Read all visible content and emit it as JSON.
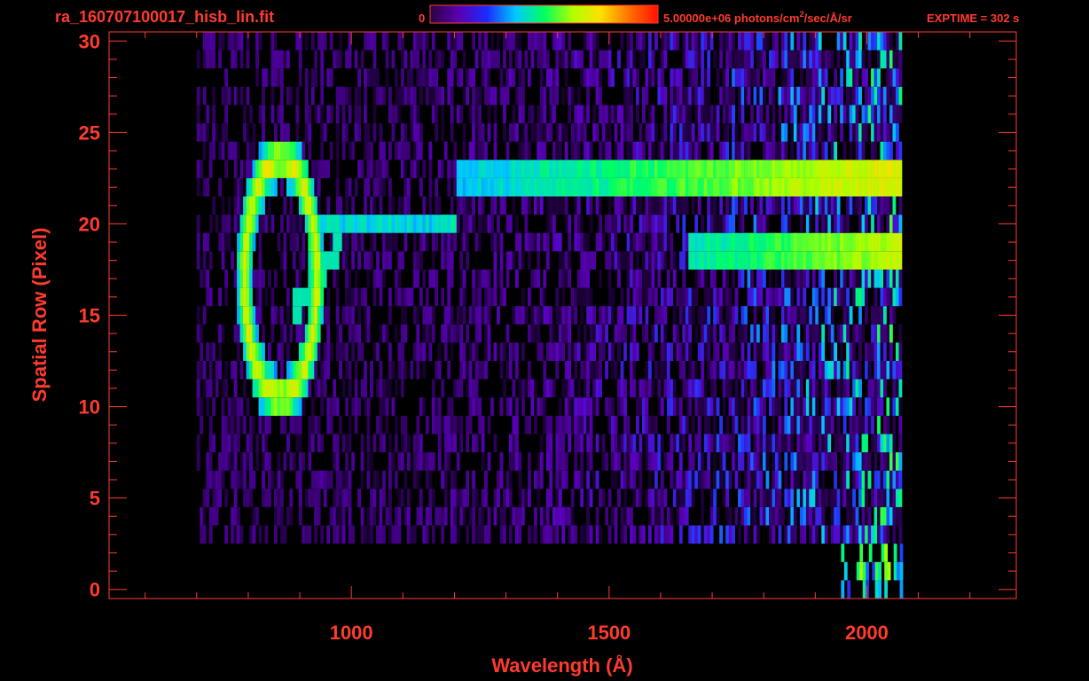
{
  "file_title": "ra_160707100017_hisb_lin.fit",
  "colorbar": {
    "min_label": "0",
    "max_label_main": "5.00000e+06 photons/cm",
    "max_label_sup": "2",
    "max_label_tail": "/sec/Å/sr",
    "stops": [
      "#2a0040",
      "#5a00b0",
      "#1a2bff",
      "#00c8ff",
      "#00ff60",
      "#b0ff00",
      "#ffe000",
      "#ff7000",
      "#ff1000"
    ]
  },
  "exptime": "EXPTIME = 302 s",
  "colors": {
    "axis": "#ff3b2f",
    "background": "#000000"
  },
  "chart_data": {
    "type": "heatmap",
    "xlabel": "Wavelength (Å)",
    "ylabel": "Spatial Row (Pixel)",
    "xlim": [
      530,
      2290
    ],
    "ylim": [
      -0.5,
      30.5
    ],
    "x_ticks": [
      1000,
      1500,
      2000
    ],
    "y_ticks": [
      0,
      5,
      10,
      15,
      20,
      25,
      30
    ],
    "grid": false,
    "data_extent_wavelength": [
      700,
      2065
    ],
    "features": [
      {
        "name": "loop",
        "center_wavelength": 860,
        "center_row": 17,
        "half_width_wavelength": 70,
        "half_height_rows": 6.5
      },
      {
        "name": "upper band",
        "row": 23,
        "wavelength_range": [
          1200,
          2065
        ]
      },
      {
        "name": "lower band",
        "row": 19,
        "wavelength_range": [
          1650,
          2065
        ]
      },
      {
        "name": "bridge",
        "row": 20,
        "wavelength_range": [
          940,
          1200
        ]
      }
    ]
  }
}
